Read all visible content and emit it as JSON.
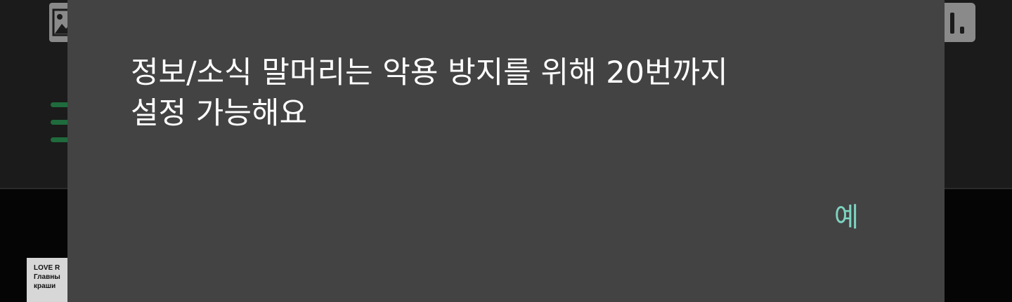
{
  "background": {
    "thumbnail_text": "LOVE R\nГлавны\nкраши"
  },
  "dialog": {
    "message": "정보/소식 말머리는 악용 방지를 위해 20번까지\n설정 가능해요",
    "confirm_label": "예",
    "accent_color": "#7dd3c0"
  },
  "icons": {
    "image": "image-icon",
    "stats": "bar-chart-icon",
    "menu": "menu-icon"
  }
}
